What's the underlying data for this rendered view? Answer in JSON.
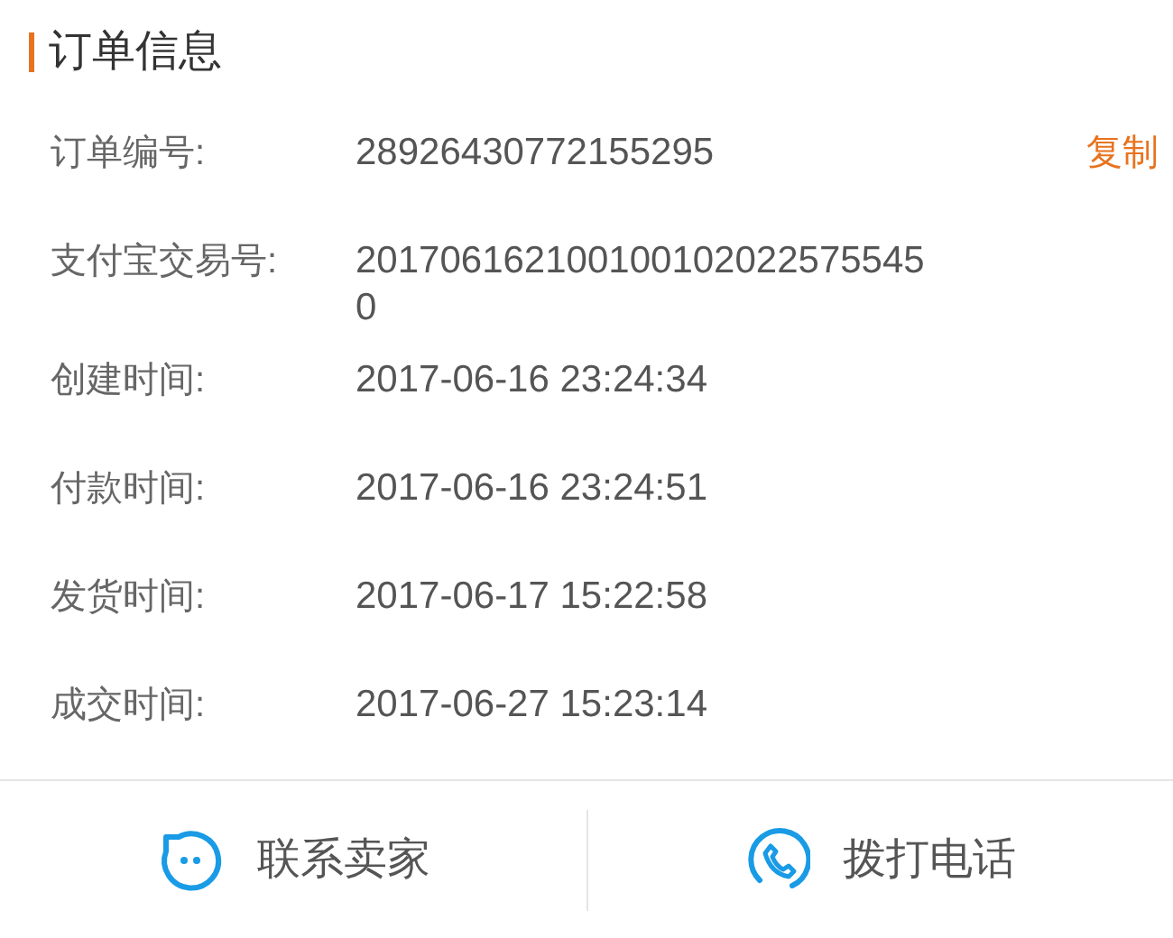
{
  "section": {
    "title": "订单信息"
  },
  "rows": [
    {
      "label": "订单编号:",
      "value": "28926430772155295",
      "action": "复制"
    },
    {
      "label": "支付宝交易号:",
      "value": "2017061621001001020225755450"
    },
    {
      "label": "创建时间:",
      "value": "2017-06-16 23:24:34"
    },
    {
      "label": "付款时间:",
      "value": "2017-06-16 23:24:51"
    },
    {
      "label": "发货时间:",
      "value": "2017-06-17 15:22:58"
    },
    {
      "label": "成交时间:",
      "value": "2017-06-27 15:23:14"
    }
  ],
  "footer": [
    {
      "kind": "chat",
      "label": "联系卖家"
    },
    {
      "kind": "phone",
      "label": "拨打电话"
    }
  ]
}
